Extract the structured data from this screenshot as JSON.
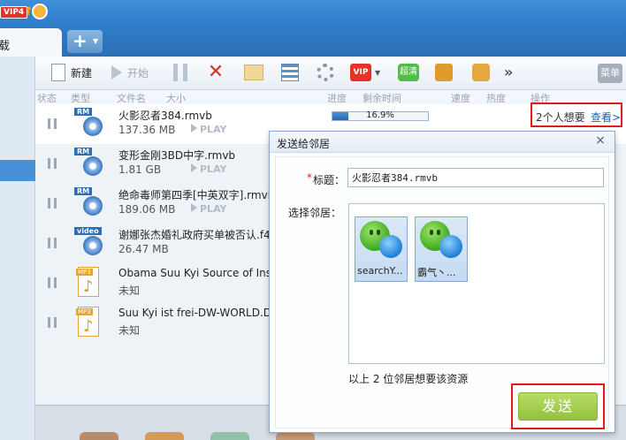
{
  "titlebar": {
    "vip_badge": "VIP4"
  },
  "tabs": {
    "active_label": "载",
    "new_tab_plus": "+"
  },
  "toolbar": {
    "new_label": "新建",
    "start_label": "开始",
    "vip_label": "VIP",
    "hd_label": "超清",
    "more": "»",
    "menu_label": "菜单"
  },
  "columns": [
    "状态",
    "类型",
    "文件名",
    "大小",
    "进度",
    "剩余时间",
    "速度",
    "热度",
    "操作"
  ],
  "files": [
    {
      "type": "RM",
      "name": "火影忍者384.rmvb",
      "size": "137.36 MB",
      "play": "PLAY"
    },
    {
      "type": "RM",
      "name": "变形金刚3BD中字.rmvb",
      "size": "1.81 GB",
      "play": "PLAY"
    },
    {
      "type": "RM",
      "name": "绝命毒师第四季[中英双字].rmvb",
      "size": "189.06 MB",
      "play": "PLAY"
    },
    {
      "type": "video",
      "name": "谢娜张杰婚礼政府买单被否认.f4",
      "size": "26.47 MB",
      "play": ""
    },
    {
      "type": "MP3",
      "name": "Obama  Suu Kyi Source of Insp",
      "size": "未知",
      "play": ""
    },
    {
      "type": "MP3",
      "name": "Suu Kyi ist frei-DW-WORLD.DE",
      "size": "未知",
      "play": ""
    }
  ],
  "progress": {
    "percent_text": "16.9%",
    "fraction": 0.169
  },
  "wanted": {
    "text": "2个人想要",
    "link": "查看>"
  },
  "dialog": {
    "title": "发送给邻居",
    "close": "×",
    "required_mark": "*",
    "title_label": "标题：",
    "title_value": "火影忍者384.rmvb",
    "neighbors_label": "选择邻居：",
    "neighbors": [
      {
        "name": "searchY..."
      },
      {
        "name": "霸气丶..."
      }
    ],
    "count_text": "以上 2 位邻居想要该资源",
    "send_label": "发送"
  },
  "colors": {
    "accent": "#2f7cc8",
    "send_green": "#93c13c",
    "highlight_red": "#e01b1b"
  }
}
